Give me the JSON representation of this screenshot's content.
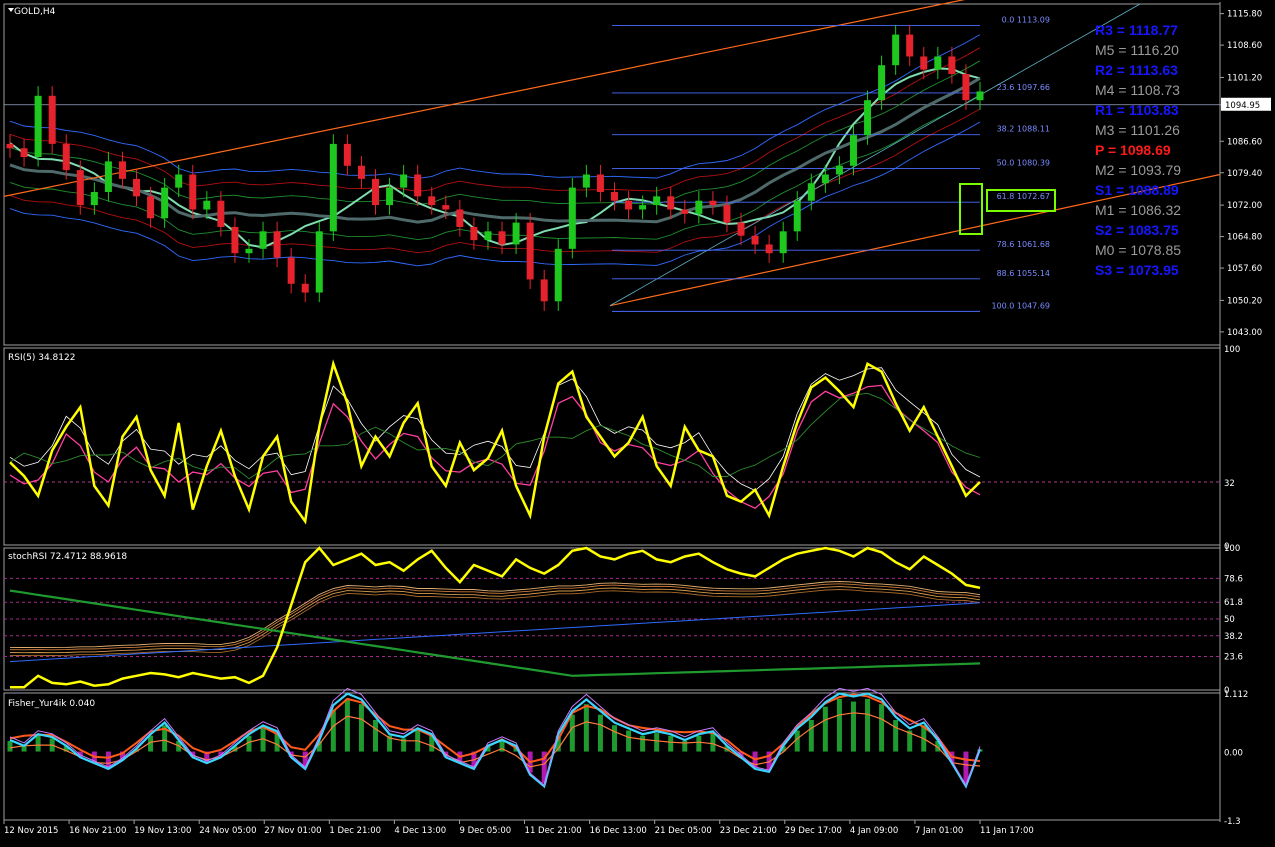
{
  "window": {
    "symbol_title": "GOLD,H4"
  },
  "colors": {
    "background": "#000000",
    "bull": "#1ec81e",
    "bear": "#e6232d",
    "fib": "#4a6cff",
    "rsi_main": "#ffff00",
    "pivot_blue": "#1616ff",
    "pivot_gray": "#9a9a9a",
    "pivot_red": "#ff1a1a",
    "highlight": "#7cfc00",
    "grid_border": "#a0a0a0"
  },
  "panels": {
    "price": {
      "title": "GOLD,H4",
      "current_price": "1094.95"
    },
    "rsi": {
      "title": "RSI(5) 34.8122"
    },
    "stoch": {
      "title": "stochRSI 72.4712 88.9618"
    },
    "fisher": {
      "title": "Fisher_Yur4ik 0.040"
    }
  },
  "chart_data": [
    {
      "type": "candlestick",
      "title": "GOLD,H4",
      "ylim": [
        1040,
        1118
      ],
      "y_ticks": [
        "1115.80",
        "1108.60",
        "1101.20",
        "1094.95",
        "1086.60",
        "1079.40",
        "1072.00",
        "1064.80",
        "1057.60",
        "1050.20",
        "1043.00"
      ],
      "x_labels": [
        "12 Nov 2015",
        "16 Nov 21:00",
        "19 Nov 13:00",
        "24 Nov 05:00",
        "27 Nov 01:00",
        "1 Dec 21:00",
        "4 Dec 13:00",
        "9 Dec 05:00",
        "11 Dec 21:00",
        "16 Dec 13:00",
        "21 Dec 05:00",
        "23 Dec 21:00",
        "29 Dec 17:00",
        "4 Jan 09:00",
        "7 Jan 01:00",
        "11 Jan 17:00"
      ],
      "close_path": [
        1085,
        1083,
        1097,
        1086,
        1080,
        1072,
        1075,
        1082,
        1078,
        1074,
        1069,
        1076,
        1079,
        1071,
        1073,
        1067,
        1061,
        1062,
        1066,
        1060,
        1054,
        1052,
        1066,
        1086,
        1081,
        1078,
        1072,
        1076,
        1079,
        1074,
        1072,
        1071,
        1067,
        1064,
        1066,
        1063,
        1068,
        1055,
        1050,
        1062,
        1076,
        1079,
        1075,
        1073,
        1071,
        1072,
        1074,
        1071,
        1070,
        1073,
        1072,
        1068,
        1065,
        1063,
        1061,
        1066,
        1073,
        1077,
        1079,
        1081,
        1088,
        1096,
        1104,
        1111,
        1106,
        1103,
        1106,
        1102,
        1096,
        1098
      ],
      "current_price": 1094.95,
      "fibonacci": [
        {
          "label": "0.0",
          "value": 1113.09
        },
        {
          "label": "23.6",
          "value": 1097.66
        },
        {
          "label": "38.2",
          "value": 1088.11
        },
        {
          "label": "50.0",
          "value": 1080.39
        },
        {
          "label": "61.8",
          "value": 1072.67
        },
        {
          "label": "78.6",
          "value": 1061.68
        },
        {
          "label": "88.6",
          "value": 1055.14
        },
        {
          "label": "100.0",
          "value": 1047.69
        }
      ],
      "pivots": [
        {
          "name": "R3",
          "value": "1118.77",
          "color": "blue"
        },
        {
          "name": "M5",
          "value": "1116.20",
          "color": "gray"
        },
        {
          "name": "R2",
          "value": "1113.63",
          "color": "blue"
        },
        {
          "name": "M4",
          "value": "1108.73",
          "color": "gray"
        },
        {
          "name": "R1",
          "value": "1103.83",
          "color": "blue"
        },
        {
          "name": "M3",
          "value": "1101.26",
          "color": "gray"
        },
        {
          "name": "P",
          "value": "1098.69",
          "color": "red"
        },
        {
          "name": "M2",
          "value": "1093.79",
          "color": "gray"
        },
        {
          "name": "S1",
          "value": "1088.89",
          "color": "blue"
        },
        {
          "name": "M1",
          "value": "1086.32",
          "color": "gray"
        },
        {
          "name": "S2",
          "value": "1083.75",
          "color": "blue"
        },
        {
          "name": "M0",
          "value": "1078.85",
          "color": "gray"
        },
        {
          "name": "S3",
          "value": "1073.95",
          "color": "blue"
        }
      ]
    },
    {
      "type": "line",
      "title": "RSI(5) 34.8122",
      "ylim": [
        0,
        100
      ],
      "y_ticks": [
        "100",
        "32",
        "0"
      ],
      "level": 32,
      "values": [
        42,
        35,
        25,
        48,
        60,
        70,
        30,
        20,
        55,
        65,
        38,
        25,
        62,
        18,
        40,
        58,
        35,
        18,
        45,
        55,
        22,
        12,
        60,
        92,
        72,
        40,
        55,
        45,
        62,
        72,
        40,
        30,
        52,
        38,
        44,
        58,
        30,
        15,
        55,
        82,
        88,
        65,
        55,
        45,
        52,
        65,
        40,
        30,
        60,
        48,
        45,
        25,
        22,
        28,
        15,
        40,
        62,
        80,
        85,
        78,
        70,
        92,
        88,
        72,
        58,
        70,
        55,
        40,
        25,
        32
      ]
    },
    {
      "type": "line",
      "title": "stochRSI 72.4712 88.9618",
      "ylim": [
        0,
        100
      ],
      "y_ticks": [
        "100",
        "78.6",
        "61.8",
        "50",
        "38.2",
        "23.6",
        "0"
      ],
      "series": [
        {
          "values": [
            2,
            2,
            10,
            5,
            4,
            6,
            3,
            4,
            8,
            10,
            12,
            11,
            9,
            12,
            10,
            8,
            9,
            5,
            10,
            30,
            60,
            90,
            100,
            88,
            92,
            96,
            88,
            90,
            84,
            92,
            98,
            86,
            76,
            88,
            84,
            80,
            92,
            86,
            82,
            88,
            98,
            100,
            94,
            92,
            96,
            98,
            92,
            90,
            94,
            96,
            90,
            85,
            82,
            80,
            86,
            92,
            96,
            98,
            100,
            98,
            94,
            100,
            97,
            90,
            85,
            94,
            88,
            82,
            74,
            72
          ]
        }
      ]
    },
    {
      "type": "bar",
      "title": "Fisher_Yur4ik 0.040",
      "ylim": [
        -1.3,
        1.112
      ],
      "y_ticks": [
        "1.112",
        "0.00",
        "-1.3"
      ],
      "values": [
        0.2,
        0.1,
        0.3,
        0.25,
        0.1,
        -0.1,
        -0.2,
        -0.3,
        -0.15,
        0.05,
        0.3,
        0.5,
        0.2,
        -0.1,
        -0.2,
        -0.1,
        0.1,
        0.3,
        0.45,
        0.35,
        -0.1,
        -0.3,
        0.2,
        0.8,
        1.0,
        0.9,
        0.6,
        0.3,
        0.25,
        0.4,
        0.3,
        -0.1,
        -0.2,
        -0.3,
        0.1,
        0.2,
        0.1,
        -0.4,
        -0.6,
        0.3,
        0.7,
        0.9,
        0.7,
        0.5,
        0.4,
        0.3,
        0.35,
        0.3,
        0.2,
        0.3,
        0.35,
        0.1,
        -0.1,
        -0.3,
        -0.35,
        0.1,
        0.4,
        0.6,
        0.85,
        1.0,
        0.95,
        1.0,
        0.9,
        0.6,
        0.4,
        0.5,
        0.2,
        -0.2,
        -0.6,
        0.04
      ]
    }
  ]
}
